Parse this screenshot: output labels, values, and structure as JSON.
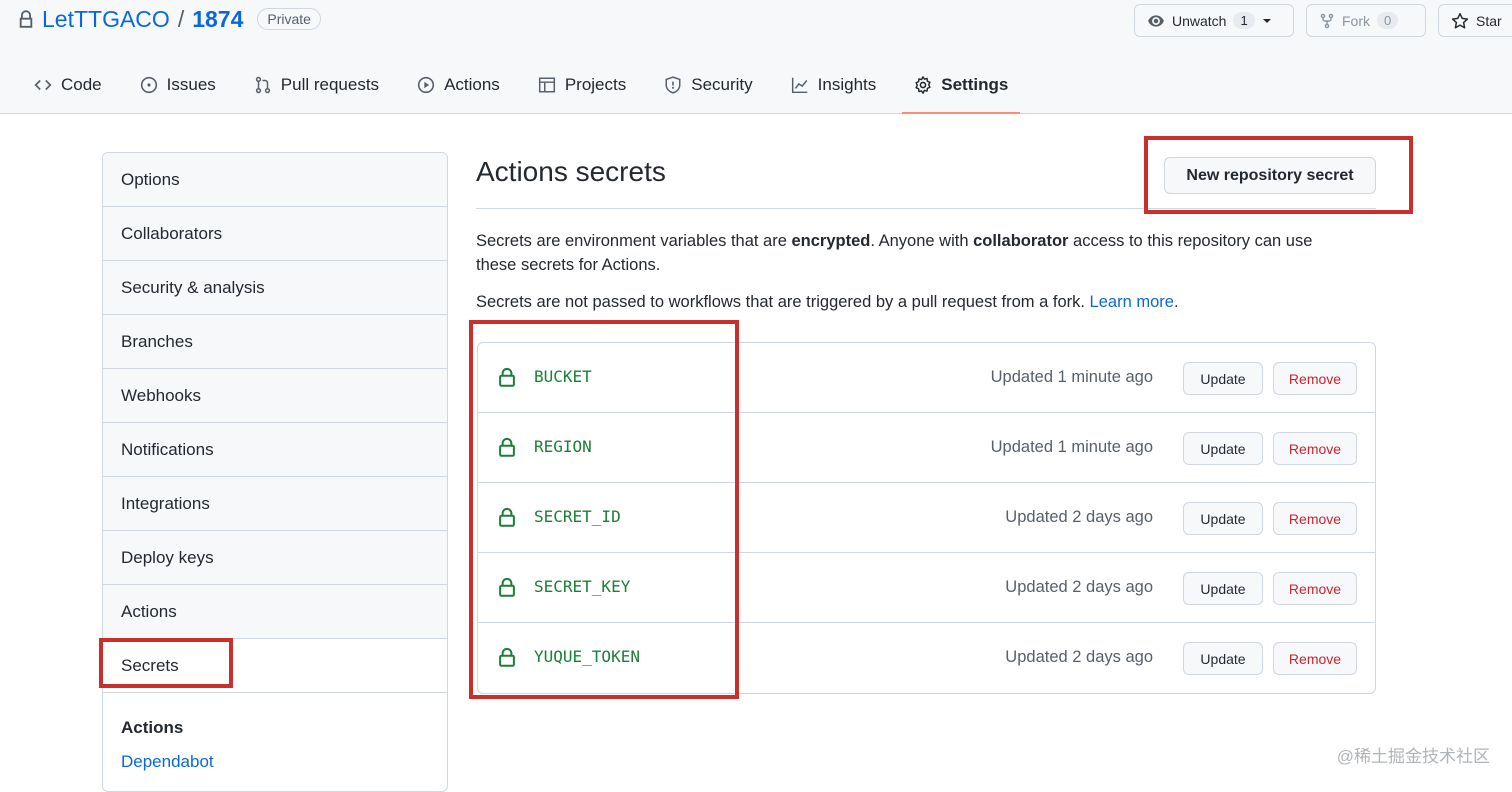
{
  "repo": {
    "owner": "LetTTGACO",
    "separator": "/",
    "name": "1874",
    "visibility": "Private"
  },
  "header_buttons": {
    "unwatch_label": "Unwatch",
    "unwatch_count": "1",
    "fork_label": "Fork",
    "fork_count": "0",
    "star_label": "Star"
  },
  "tabs": [
    {
      "label": "Code",
      "icon": "code-icon"
    },
    {
      "label": "Issues",
      "icon": "issue-icon"
    },
    {
      "label": "Pull requests",
      "icon": "pull-request-icon"
    },
    {
      "label": "Actions",
      "icon": "play-icon"
    },
    {
      "label": "Projects",
      "icon": "table-icon"
    },
    {
      "label": "Security",
      "icon": "shield-icon"
    },
    {
      "label": "Insights",
      "icon": "graph-icon"
    },
    {
      "label": "Settings",
      "icon": "gear-icon",
      "selected": true
    }
  ],
  "sidebar": {
    "items": [
      "Options",
      "Collaborators",
      "Security & analysis",
      "Branches",
      "Webhooks",
      "Notifications",
      "Integrations",
      "Deploy keys",
      "Actions",
      "Secrets"
    ],
    "selected": "Secrets",
    "sub_heading": "Actions",
    "sub_link": "Dependabot"
  },
  "main": {
    "title": "Actions secrets",
    "new_secret_button": "New repository secret",
    "desc1_part1": "Secrets are environment variables that are ",
    "desc1_bold1": "encrypted",
    "desc1_part2": ". Anyone with ",
    "desc1_bold2": "collaborator",
    "desc1_part3": " access to this repository can use these secrets for Actions.",
    "desc2_text": "Secrets are not passed to workflows that are triggered by a pull request from a fork. ",
    "desc2_link": "Learn more",
    "desc2_end": "."
  },
  "secrets": [
    {
      "name": "BUCKET",
      "updated": "Updated 1 minute ago"
    },
    {
      "name": "REGION",
      "updated": "Updated 1 minute ago"
    },
    {
      "name": "SECRET_ID",
      "updated": "Updated 2 days ago"
    },
    {
      "name": "SECRET_KEY",
      "updated": "Updated 2 days ago"
    },
    {
      "name": "YUQUE_TOKEN",
      "updated": "Updated 2 days ago"
    }
  ],
  "secret_buttons": {
    "update": "Update",
    "remove": "Remove"
  },
  "colors": {
    "annotation": "#c9302c",
    "link": "#0969da",
    "secret_name": "#1a7f37",
    "remove": "#cf222e",
    "selected_tab_underline": "#fd8c73"
  },
  "watermark": "@稀土掘金技术社区"
}
